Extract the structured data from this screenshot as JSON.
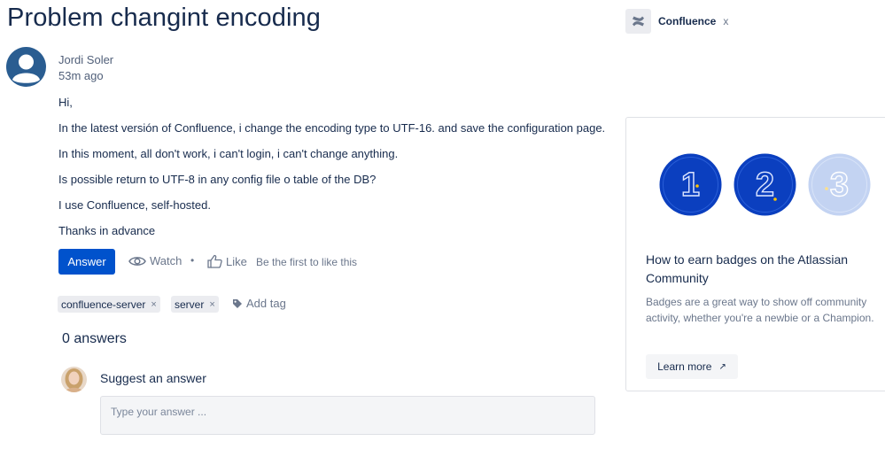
{
  "question": {
    "title": "Problem changint encoding",
    "author": "Jordi Soler",
    "time": "53m ago",
    "paragraphs": [
      "Hi,",
      "In the latest versión of Confluence, i change the encoding type to UTF-16. and save the configuration page.",
      "In this moment, all don't work, i can't login, i can't change anything.",
      "Is possible return to UTF-8 in any config file o table of the DB?",
      "I use Confluence, self-hosted.",
      "Thanks in advance"
    ]
  },
  "actions": {
    "answer_label": "Answer",
    "watch_label": "Watch",
    "separator": "•",
    "like_label": "Like",
    "like_hint": "Be the first to like this"
  },
  "tags": [
    {
      "label": "confluence-server",
      "remove": "×"
    },
    {
      "label": "server",
      "remove": "×"
    }
  ],
  "add_tag_label": "Add tag",
  "answers": {
    "count_label": "0 answers",
    "suggest_label": "Suggest an answer",
    "input_placeholder": "Type your answer ..."
  },
  "sidebar": {
    "space_label": "Confluence",
    "space_remove": "x",
    "card": {
      "badges": [
        "1",
        "2",
        "3"
      ],
      "title": "How to earn badges on the Atlassian Community",
      "body": "Badges are a great way to show off community activity, whether you're a newbie or a Champion.",
      "button_label": "Learn more",
      "button_icon": "↗"
    }
  },
  "colors": {
    "primary": "#0052cc",
    "text": "#172b4d",
    "muted": "#6b778c",
    "badge_dark": "#0b3fbf",
    "badge_light": "#c3d3f2"
  }
}
